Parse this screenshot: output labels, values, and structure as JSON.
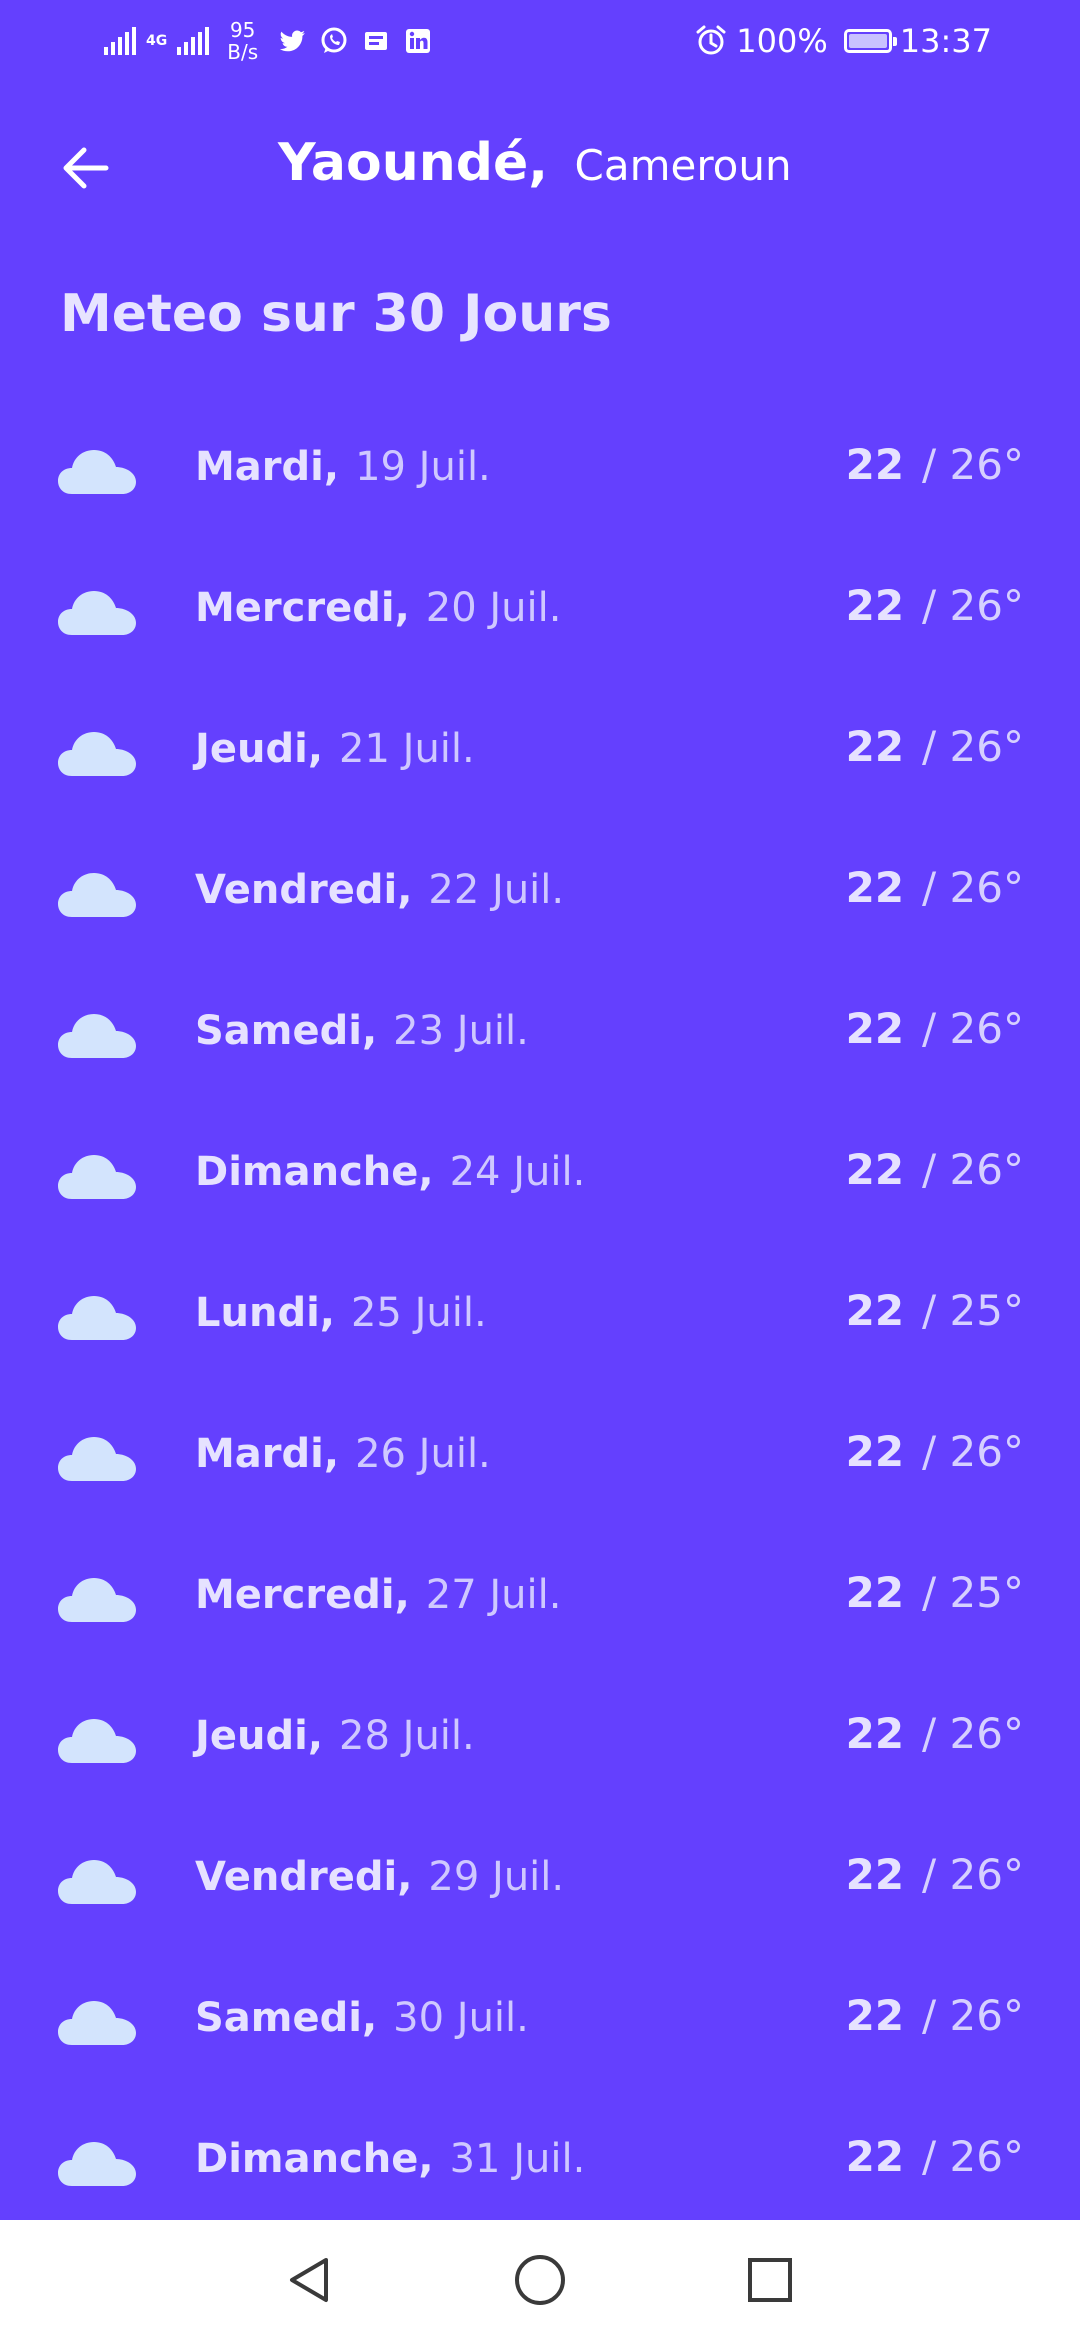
{
  "status_bar": {
    "network_type": "4G",
    "speed_value": "95",
    "speed_unit": "B/s",
    "battery": "100%",
    "time": "13:37"
  },
  "header": {
    "city": "Yaoundé,",
    "country": "Cameroun"
  },
  "section_title": "Meteo sur 30 Jours",
  "forecast": [
    {
      "day": "Mardi,",
      "date": "19 Juil.",
      "low": "22",
      "high": "/ 26°",
      "icon": "cloud-icon"
    },
    {
      "day": "Mercredi,",
      "date": "20 Juil.",
      "low": "22",
      "high": "/ 26°",
      "icon": "cloud-icon"
    },
    {
      "day": "Jeudi,",
      "date": "21 Juil.",
      "low": "22",
      "high": "/ 26°",
      "icon": "cloud-icon"
    },
    {
      "day": "Vendredi,",
      "date": "22 Juil.",
      "low": "22",
      "high": "/ 26°",
      "icon": "cloud-icon"
    },
    {
      "day": "Samedi,",
      "date": "23 Juil.",
      "low": "22",
      "high": "/ 26°",
      "icon": "cloud-icon"
    },
    {
      "day": "Dimanche,",
      "date": "24 Juil.",
      "low": "22",
      "high": "/ 26°",
      "icon": "cloud-icon"
    },
    {
      "day": "Lundi,",
      "date": "25 Juil.",
      "low": "22",
      "high": "/ 25°",
      "icon": "cloud-icon"
    },
    {
      "day": "Mardi,",
      "date": "26 Juil.",
      "low": "22",
      "high": "/ 26°",
      "icon": "cloud-icon"
    },
    {
      "day": "Mercredi,",
      "date": "27 Juil.",
      "low": "22",
      "high": "/ 25°",
      "icon": "cloud-icon"
    },
    {
      "day": "Jeudi,",
      "date": "28 Juil.",
      "low": "22",
      "high": "/ 26°",
      "icon": "cloud-icon"
    },
    {
      "day": "Vendredi,",
      "date": "29 Juil.",
      "low": "22",
      "high": "/ 26°",
      "icon": "cloud-icon"
    },
    {
      "day": "Samedi,",
      "date": "30 Juil.",
      "low": "22",
      "high": "/ 26°",
      "icon": "cloud-icon"
    },
    {
      "day": "Dimanche,",
      "date": "31 Juil.",
      "low": "22",
      "high": "/ 26°",
      "icon": "cloud-icon"
    }
  ],
  "colors": {
    "background": "#6440fe",
    "cloud": "#d3e4fd",
    "nav_bar": "#ffffff",
    "nav_icon": "#3a3a3a"
  }
}
